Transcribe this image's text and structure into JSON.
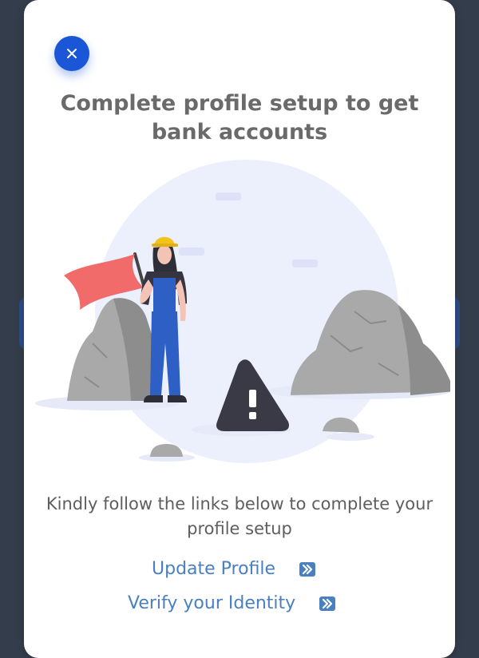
{
  "modal": {
    "close_icon": "close-icon",
    "title": "Complete profile setup to get bank accounts",
    "illustration": "worker-with-flag-warning-illustration",
    "message": "Kindly follow the links below to complete your profile setup",
    "links": [
      {
        "label": "Update Profile",
        "icon": "double-chevron-right-icon"
      },
      {
        "label": "Verify your Identity",
        "icon": "double-chevron-right-icon"
      }
    ]
  },
  "colors": {
    "accent": "#1a56d6",
    "link": "#4a7fc0",
    "title": "#6a6a6a",
    "backdrop": "#343d4b"
  }
}
